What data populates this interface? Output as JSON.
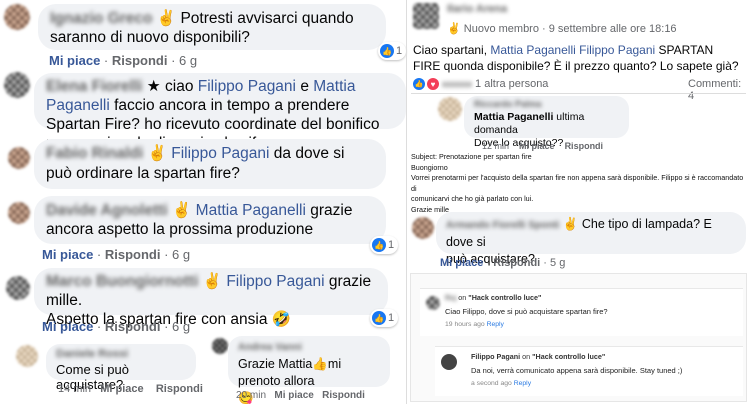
{
  "left": {
    "c1": {
      "name": "Ignazio Greco",
      "text": "Potresti avvisarci quando saranno di nuovo disponibili?",
      "like": "Mi piace",
      "reply": "Rispondi",
      "time": "6 g",
      "likes": "1"
    },
    "c2": {
      "name": "Elena Fiorelli",
      "mention1": "Filippo Pagani",
      "mid": "e",
      "mention2": "Mattia Paganelli",
      "pre": "ciao",
      "text": "faccio ancora in tempo a prendere Spartan Fire? ho ricevuto coordinate del bonifico ma non ricordo di preciso la cifra...."
    },
    "c3": {
      "name": "Fabio Rinaldi",
      "mention": "Filippo Pagani",
      "text": "da dove si può ordinare la spartan fire?"
    },
    "c4": {
      "name": "Davide Agnoletti",
      "mention": "Mattia Paganelli",
      "text": "grazie ancora aspetto la prossima produzione",
      "like": "Mi piace",
      "reply": "Rispondi",
      "time": "6 g",
      "likes": "1"
    },
    "c5": {
      "name": "Marco Buongiornotti",
      "mention": "Filippo Pagani",
      "text1": "grazie mille.",
      "text2": "Aspetto la spartan fire con ansia",
      "like": "Mi piace",
      "reply": "Rispondi",
      "time": "6 g",
      "likes": "1"
    },
    "c6": {
      "name": "Daniele Rossi",
      "text": "Come si può acquistare?",
      "time": "14 min",
      "like": "Mi piace",
      "reply": "Rispondi"
    },
    "c7": {
      "name": "Andrea Vanni",
      "text": "Grazie Mattia",
      "text_b": "mi prenoto allora",
      "time": "20 min",
      "like": "Mi piace",
      "reply": "Rispondi"
    }
  },
  "right": {
    "post": {
      "name": "Ilario Arena",
      "badge": "Nuovo membro",
      "date": "· 9 settembre alle ore 18:16",
      "text_pre": "Ciao spartani,",
      "mention1": "Mattia Paganelli",
      "mention2": "Filippo Pagani",
      "text_post": "SPARTAN FIRE quonda disponibile? È il prezzo quanto? Lo sapete già?",
      "reactions": "1 altra persona",
      "comments": "Commenti: 4"
    },
    "reply": {
      "name": "Riccardo Palma",
      "mention": "Mattia Paganelli",
      "text1": "ultima domanda",
      "text2": "Dove lo acquisto??",
      "time": "12 min",
      "like": "Mi piace",
      "reply": "Rispondi"
    },
    "email": {
      "subject": "Subject: Prenotazione per spartan fire",
      "greeting": "Buongiorno",
      "body1": "Vorrei prenotarmi per l'acquisto della spartan fire non appena sarà disponibile. Filippo si è raccomandato di",
      "body2": "comunicarvi che ho già parlato con lui.",
      "closing": "Grazie mille"
    },
    "c8": {
      "name": "Armando Fiorelli Sponti",
      "text1": "Che tipo di lampada? E dove si",
      "text2": "può acquistare?",
      "like": "Mi piace",
      "reply": "Rispondi",
      "time": "5 g"
    },
    "box": {
      "q": {
        "name": "Ruj",
        "on": "on",
        "post": "\"Hack controllo luce\"",
        "text": "Ciao Filippo, dove si può acquistare spartan fire?",
        "time": "19 hours ago",
        "reply": "Reply"
      },
      "a": {
        "name": "Filippo Pagani",
        "on": "on",
        "post": "\"Hack controllo luce\"",
        "text": "Da noi, verrà comunicato appena sarà disponibile. Stay tuned ;)",
        "time": "a second ago",
        "reply": "Reply"
      }
    }
  }
}
